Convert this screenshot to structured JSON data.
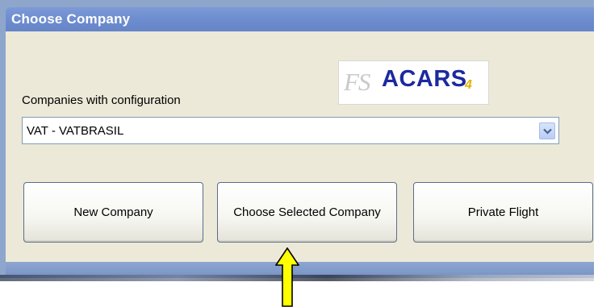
{
  "window": {
    "title": "Choose Company"
  },
  "logo": {
    "prefix": "FS",
    "name": "ACARS",
    "version": "4"
  },
  "companies": {
    "label": "Companies with configuration",
    "selected": "VAT - VATBRASIL"
  },
  "buttons": {
    "new_company": "New Company",
    "choose_selected": "Choose Selected Company",
    "private_flight": "Private Flight"
  },
  "colors": {
    "title_bar": "#7190d2",
    "client_bg": "#ece9d8",
    "logo_blue": "#1b2a9e",
    "annotation_arrow": "#ffff00"
  },
  "icons": {
    "dropdown": "chevron-down-icon",
    "annotation": "arrow-up-icon"
  }
}
